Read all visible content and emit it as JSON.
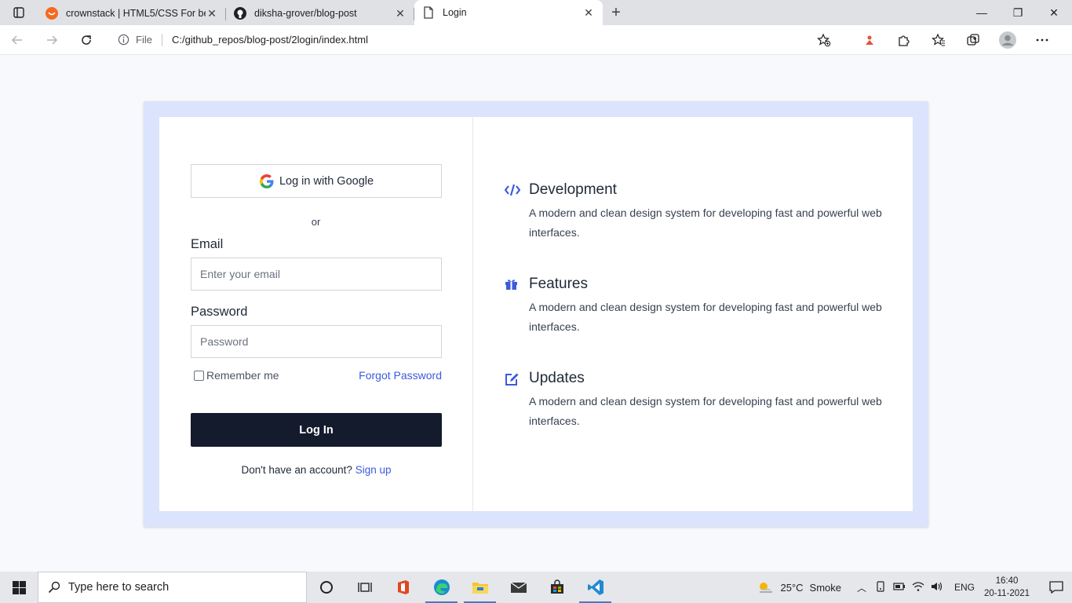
{
  "browser": {
    "tabs": [
      {
        "title": "crownstack | HTML5/CSS For beginners",
        "active": false,
        "icon": "crownstack-favicon"
      },
      {
        "title": "diksha-grover/blog-post",
        "active": false,
        "icon": "github-icon"
      },
      {
        "title": "Login",
        "active": true,
        "icon": "page-icon"
      }
    ],
    "address": {
      "scheme_label": "File",
      "url": "C:/github_repos/blog-post/2login/index.html"
    }
  },
  "login": {
    "google_button": "Log in with Google",
    "or_text": "or",
    "email_label": "Email",
    "email_placeholder": "Enter your email",
    "password_label": "Password",
    "password_placeholder": "Password",
    "remember_label": "Remember me",
    "forgot_link": "Forgot Password",
    "submit_label": "Log In",
    "signup_prompt": "Don't have an account?",
    "signup_link": "Sign up"
  },
  "features": [
    {
      "title": "Development",
      "description": "A modern and clean design system for developing fast and powerful web interfaces.",
      "icon": "code-icon"
    },
    {
      "title": "Features",
      "description": "A modern and clean design system for developing fast and powerful web interfaces.",
      "icon": "gift-icon"
    },
    {
      "title": "Updates",
      "description": "A modern and clean design system for developing fast and powerful web interfaces.",
      "icon": "edit-icon"
    }
  ],
  "taskbar": {
    "search_placeholder": "Type here to search",
    "weather_temp": "25°C",
    "weather_condition": "Smoke",
    "language": "ENG",
    "time": "16:40",
    "date": "20-11-2021"
  },
  "colors": {
    "accent": "#3b5bdb",
    "card_border": "#dbe4fc",
    "primary_button": "#141b2d"
  }
}
